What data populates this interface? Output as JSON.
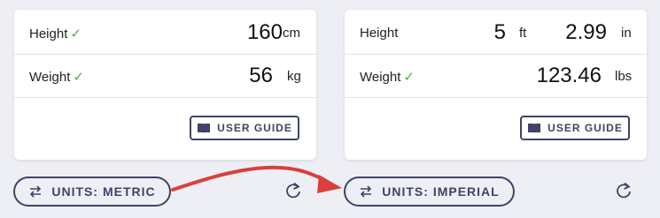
{
  "metric": {
    "height_label": "Height",
    "height_check": "✓",
    "height_value": "160",
    "height_unit": "cm",
    "weight_label": "Weight",
    "weight_check": "✓",
    "weight_value": "56",
    "weight_unit": "kg",
    "guide_label": "USER GUIDE",
    "units_label": "UNITS: METRIC"
  },
  "imperial": {
    "height_label": "Height",
    "height_ft_value": "5",
    "height_ft_unit": "ft",
    "height_in_value": "2.99",
    "height_in_unit": "in",
    "weight_label": "Weight",
    "weight_check": "✓",
    "weight_value": "123.46",
    "weight_unit": "lbs",
    "guide_label": "USER GUIDE",
    "units_label": "UNITS: IMPERIAL"
  },
  "colors": {
    "accent": "#3d4466",
    "check": "#4caf50",
    "annotation_arrow": "#d9403a",
    "background": "#eeeff4"
  }
}
